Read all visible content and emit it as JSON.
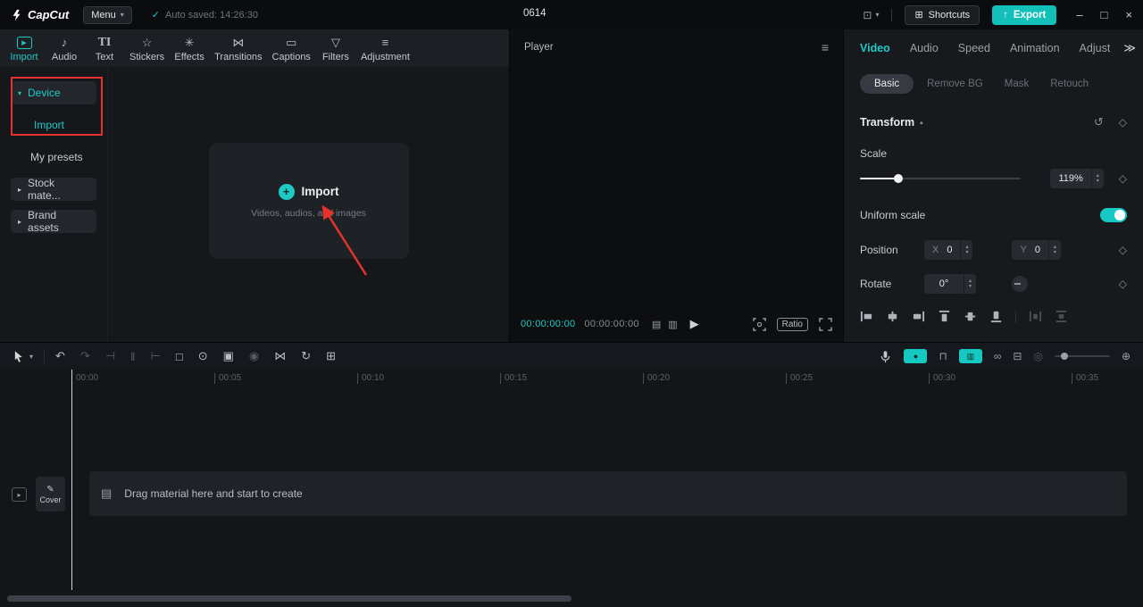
{
  "titlebar": {
    "app_name": "CapCut",
    "menu_label": "Menu",
    "autosave_text": "Auto saved: 14:26:30",
    "project_title": "0614",
    "shortcuts_label": "Shortcuts",
    "export_label": "Export"
  },
  "media_panel": {
    "tabs": [
      {
        "label": "Import"
      },
      {
        "label": "Audio"
      },
      {
        "label": "Text"
      },
      {
        "label": "Stickers"
      },
      {
        "label": "Effects"
      },
      {
        "label": "Transitions"
      },
      {
        "label": "Captions"
      },
      {
        "label": "Filters"
      },
      {
        "label": "Adjustment"
      }
    ],
    "sidebar": [
      {
        "label": "Device"
      },
      {
        "label": "Import"
      },
      {
        "label": "My presets"
      },
      {
        "label": "Stock mate..."
      },
      {
        "label": "Brand assets"
      }
    ],
    "dropzone": {
      "title": "Import",
      "subtitle": "Videos, audios, and images"
    }
  },
  "player": {
    "title": "Player",
    "current_time": "00:00:00:00",
    "duration": "00:00:00:00",
    "ratio_label": "Ratio"
  },
  "inspector": {
    "tabs": [
      {
        "label": "Video"
      },
      {
        "label": "Audio"
      },
      {
        "label": "Speed"
      },
      {
        "label": "Animation"
      },
      {
        "label": "Adjust"
      }
    ],
    "more": "≫",
    "subtabs": [
      {
        "label": "Basic"
      },
      {
        "label": "Remove BG"
      },
      {
        "label": "Mask"
      },
      {
        "label": "Retouch"
      }
    ],
    "transform": {
      "title": "Transform",
      "scale_label": "Scale",
      "scale_value": "119%",
      "uniform_label": "Uniform scale",
      "uniform_on": true,
      "position_label": "Position",
      "x_prefix": "X",
      "x_value": "0",
      "y_prefix": "Y",
      "y_value": "0",
      "rotate_label": "Rotate",
      "rotate_value": "0°"
    }
  },
  "timeline": {
    "cover_label": "Cover",
    "empty_message": "Drag material here and start to create",
    "ruler": [
      "00:00",
      "00:05",
      "00:10",
      "00:15",
      "00:20",
      "00:25",
      "00:30",
      "00:35"
    ]
  },
  "colors": {
    "accent": "#1fc9c5",
    "export_button": "#12bfb9",
    "annotation": "#e5322d"
  },
  "icons": {
    "check": "✓",
    "caret_down": "▾",
    "caret_right": "▸",
    "caret_up": "▴",
    "monitor": "⊡",
    "keyboard": "⊞",
    "export_arrow": "↑",
    "minimize": "–",
    "maximize": "□",
    "close": "×",
    "hamburger": "≡",
    "media_import": "▶",
    "media_audio": "♪",
    "media_text": "TI",
    "media_stickers": "☆",
    "media_effects": "✳",
    "media_transitions": "⋈",
    "media_captions": "▭",
    "media_filters": "▽",
    "media_adjustment": "≡",
    "plus": "+",
    "prev_frame": "▤",
    "next_frame": "▥",
    "play": "▶",
    "reset": "↺",
    "keyframe": "◇",
    "undo": "↶",
    "redo": "↷",
    "trim_left": "⊣",
    "split": "‖",
    "trim_right": "⊢",
    "delete": "□",
    "mask": "⊙",
    "overlay": "▣",
    "freeze": "◉",
    "mirror": "⋈",
    "rotate": "↻",
    "crop": "⊞",
    "record": "●",
    "magnet": "⊓",
    "preview": "▥",
    "link": "∞",
    "multicam": "⊟",
    "zoom_dim": "◎",
    "fit": "⊕",
    "pencil": "✎",
    "film": "▤",
    "main_track": "▸"
  }
}
